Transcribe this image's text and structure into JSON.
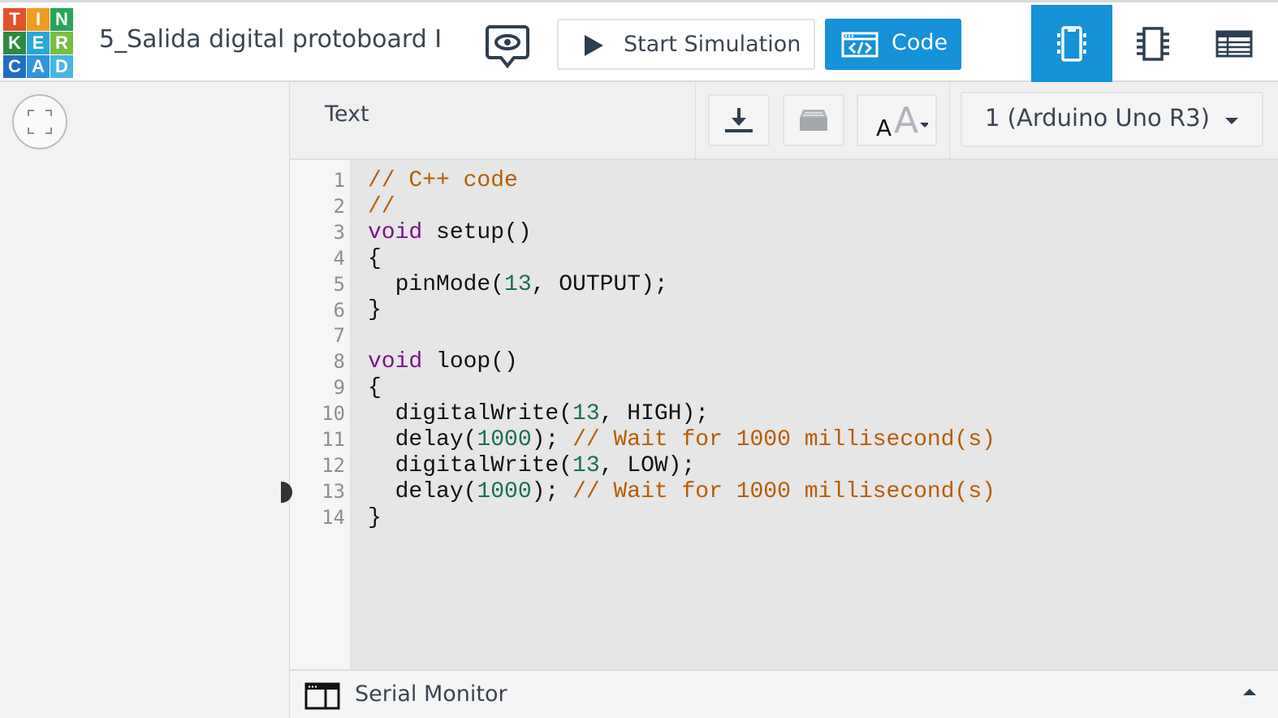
{
  "logo": {
    "letters": [
      "T",
      "I",
      "N",
      "K",
      "E",
      "R",
      "C",
      "A",
      "D"
    ],
    "colors": [
      "#e3502a",
      "#f29c1f",
      "#27a55a",
      "#2e8a3e",
      "#2aa8d6",
      "#78be43",
      "#1f6fc0",
      "#2f95dc",
      "#48b5e6"
    ]
  },
  "header": {
    "project_title": "5_Salida digital protoboard I",
    "start_simulation_label": "Start Simulation",
    "code_label": "Code",
    "accent": "#1592d8"
  },
  "editor_toolbar": {
    "mode_label": "Text",
    "board_select": "1 (Arduino Uno R3)"
  },
  "code_lines": [
    {
      "n": "1",
      "tokens": [
        {
          "t": "// C++ code",
          "k": "comment"
        }
      ]
    },
    {
      "n": "2",
      "tokens": [
        {
          "t": "//",
          "k": "comment"
        }
      ]
    },
    {
      "n": "3",
      "tokens": [
        {
          "t": "void",
          "k": "kw"
        },
        {
          "t": " setup()",
          "k": "plain"
        }
      ]
    },
    {
      "n": "4",
      "tokens": [
        {
          "t": "{",
          "k": "plain"
        }
      ]
    },
    {
      "n": "5",
      "tokens": [
        {
          "t": "  pinMode(",
          "k": "plain"
        },
        {
          "t": "13",
          "k": "num"
        },
        {
          "t": ", OUTPUT);",
          "k": "plain"
        }
      ]
    },
    {
      "n": "6",
      "tokens": [
        {
          "t": "}",
          "k": "plain"
        }
      ]
    },
    {
      "n": "7",
      "tokens": []
    },
    {
      "n": "8",
      "tokens": [
        {
          "t": "void",
          "k": "kw"
        },
        {
          "t": " loop()",
          "k": "plain"
        }
      ]
    },
    {
      "n": "9",
      "tokens": [
        {
          "t": "{",
          "k": "plain"
        }
      ]
    },
    {
      "n": "10",
      "tokens": [
        {
          "t": "  digitalWrite(",
          "k": "plain"
        },
        {
          "t": "13",
          "k": "num"
        },
        {
          "t": ", HIGH);",
          "k": "plain"
        }
      ]
    },
    {
      "n": "11",
      "tokens": [
        {
          "t": "  delay(",
          "k": "plain"
        },
        {
          "t": "1000",
          "k": "num"
        },
        {
          "t": "); ",
          "k": "plain"
        },
        {
          "t": "// Wait for 1000 millisecond(s)",
          "k": "comment"
        }
      ]
    },
    {
      "n": "12",
      "tokens": [
        {
          "t": "  digitalWrite(",
          "k": "plain"
        },
        {
          "t": "13",
          "k": "num"
        },
        {
          "t": ", LOW);",
          "k": "plain"
        }
      ]
    },
    {
      "n": "13",
      "tokens": [
        {
          "t": "  delay(",
          "k": "plain"
        },
        {
          "t": "1000",
          "k": "num"
        },
        {
          "t": "); ",
          "k": "plain"
        },
        {
          "t": "// Wait for 1000 millisecond(s)",
          "k": "comment"
        }
      ]
    },
    {
      "n": "14",
      "tokens": [
        {
          "t": "}",
          "k": "plain"
        }
      ]
    }
  ],
  "serial_monitor": {
    "label": "Serial Monitor"
  },
  "icons": {
    "chat": "speech-bubble-eye-icon",
    "play": "play-icon",
    "code": "code-window-icon",
    "circuit_view": "circuit-view-icon",
    "schematic_view": "schematic-chip-icon",
    "component_list": "component-list-icon",
    "fit": "fit-to-view-icon",
    "download": "download-icon",
    "library": "library-tray-icon",
    "font_size": "font-size-icon",
    "serial": "serial-monitor-icon"
  }
}
